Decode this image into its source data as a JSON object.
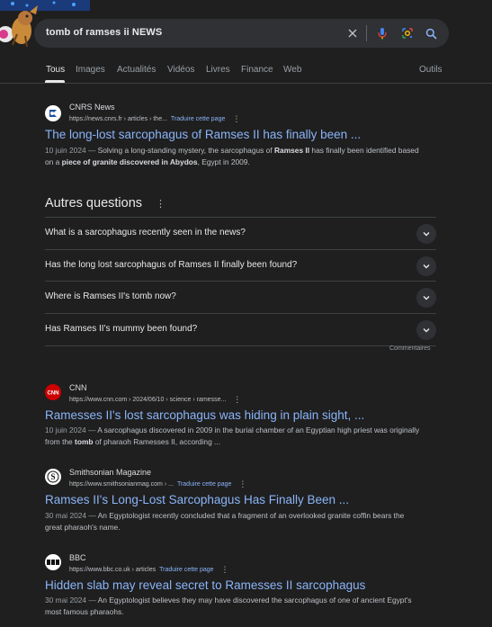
{
  "search": {
    "query": "tomb of ramses ii NEWS"
  },
  "tabs": [
    "Tous",
    "Images",
    "Actualités",
    "Vidéos",
    "Livres",
    "Finance",
    "Web"
  ],
  "tools_label": "Outils",
  "icons": {
    "clear": "close-icon",
    "voice": "microphone-icon",
    "lens": "camera-lens-icon",
    "search": "search-icon",
    "more": "three-dot-menu-icon",
    "expand": "chevron-down-icon"
  },
  "colors": {
    "link": "#8ab4f8",
    "background": "#1f1f1f",
    "cnn_red": "#cc0000"
  },
  "results": [
    {
      "source": "CNRS News",
      "url": "https://news.cnrs.fr › articles › the...",
      "translate": "Traduire cette page",
      "title": "The long-lost sarcophagus of Ramses II has finally been ...",
      "date": "10 juin 2024 — ",
      "snippet_html": "Solving a long-standing mystery, the sarcophagus of <b>Ramses II</b> has finally been identified based on a <b>piece of granite discovered in Abydos</b>, Egypt in 2009."
    }
  ],
  "paa": {
    "title": "Autres questions",
    "questions": [
      "What is a sarcophagus recently seen in the news?",
      "Has the long lost sarcophagus of Ramses II finally been found?",
      "Where is Ramses II's tomb now?",
      "Has Ramses II's mummy been found?"
    ],
    "feedback": "Commentaires"
  },
  "results2": [
    {
      "source": "CNN",
      "url": "https://www.cnn.com › 2024/06/10 › science › ramesse...",
      "translate": "",
      "title": "Ramesses II's lost sarcophagus was hiding in plain sight, ...",
      "date": "10 juin 2024 — ",
      "snippet_html": "A sarcophagus discovered in 2009 in the burial chamber of an Egyptian high priest was originally from the <b>tomb</b> of pharaoh Ramesses II, according ..."
    },
    {
      "source": "Smithsonian Magazine",
      "url": "https://www.smithsonianmag.com › ...",
      "translate": "Traduire cette page",
      "title": "Ramses II's Long-Lost Sarcophagus Has Finally Been ...",
      "date": "30 mai 2024 — ",
      "snippet_html": "An Egyptologist recently concluded that a fragment of an overlooked granite coffin bears the great pharaoh's name."
    },
    {
      "source": "BBC",
      "url": "https://www.bbc.co.uk › articles",
      "translate": "Traduire cette page",
      "title": "Hidden slab may reveal secret to Ramesses II sarcophagus",
      "date": "30 mai 2024 — ",
      "snippet_html": "An Egyptologist believes they may have discovered the sarcophagus of one of ancient Egypt's most famous pharaohs."
    }
  ]
}
